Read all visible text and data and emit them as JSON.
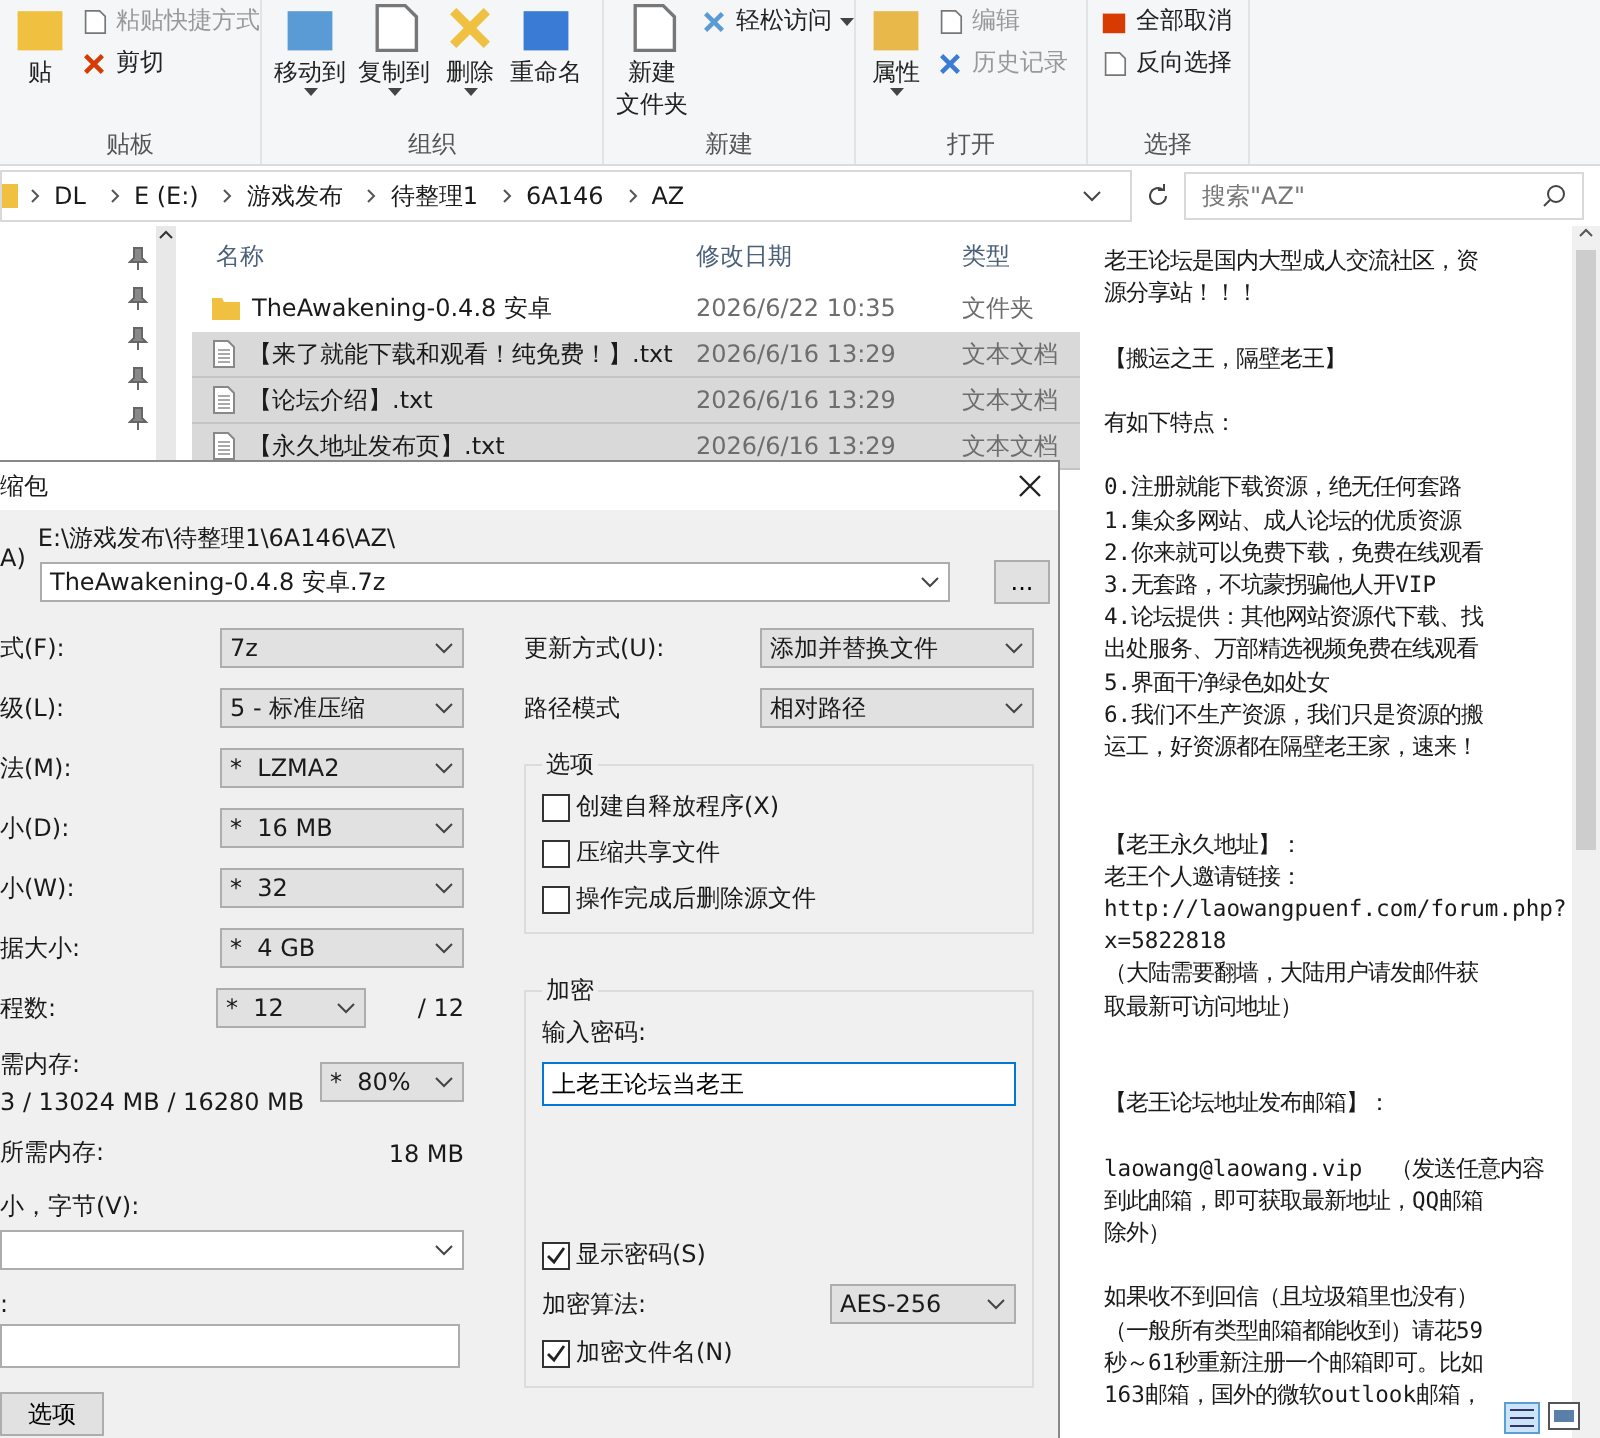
{
  "ribbon": {
    "groups": [
      {
        "label": "贴板",
        "items": [
          {
            "lines": [
              "贴"
            ],
            "kind": "large",
            "disabled": false,
            "dropdown": false
          },
          {
            "lines": [
              "粘贴快捷方式"
            ],
            "kind": "small",
            "disabled": true,
            "dropdown": false
          },
          {
            "lines": [
              "剪切"
            ],
            "kind": "small",
            "disabled": false,
            "dropdown": false
          }
        ]
      },
      {
        "label": "组织",
        "items": [
          {
            "lines": [
              "移动到"
            ],
            "kind": "large",
            "disabled": false,
            "dropdown": true
          },
          {
            "lines": [
              "复制到"
            ],
            "kind": "large",
            "disabled": false,
            "dropdown": true
          },
          {
            "lines": [
              "删除"
            ],
            "kind": "large",
            "disabled": false,
            "dropdown": true
          },
          {
            "lines": [
              "重命名"
            ],
            "kind": "large",
            "disabled": false,
            "dropdown": false
          }
        ]
      },
      {
        "label": "新建",
        "items": [
          {
            "lines": [
              "新建",
              "文件夹"
            ],
            "kind": "large",
            "disabled": false,
            "dropdown": false
          },
          {
            "lines": [
              "轻松访问"
            ],
            "kind": "small",
            "disabled": false,
            "dropdown": true
          }
        ]
      },
      {
        "label": "打开",
        "items": [
          {
            "lines": [
              "属性"
            ],
            "kind": "large",
            "disabled": false,
            "dropdown": true
          },
          {
            "lines": [
              "编辑"
            ],
            "kind": "small",
            "disabled": true,
            "dropdown": false
          },
          {
            "lines": [
              "历史记录"
            ],
            "kind": "small",
            "disabled": true,
            "dropdown": false
          }
        ]
      },
      {
        "label": "选择",
        "items": [
          {
            "lines": [
              "全部取消"
            ],
            "kind": "small",
            "disabled": false,
            "dropdown": false
          },
          {
            "lines": [
              "反向选择"
            ],
            "kind": "small",
            "disabled": false,
            "dropdown": false
          }
        ]
      }
    ]
  },
  "address": {
    "crumbs": [
      "DL",
      "E (E:)",
      "游戏发布",
      "待整理1",
      "6A146",
      "AZ"
    ],
    "search_placeholder": "搜索\"AZ\""
  },
  "files": {
    "columns": [
      "名称",
      "修改日期",
      "类型"
    ],
    "rows": [
      {
        "name": "TheAwakening-0.4.8 安卓",
        "date": "2026/6/22 10:35",
        "type": "文件夹",
        "kind": "folder",
        "selected": false
      },
      {
        "name": "【来了就能下载和观看！纯免费！】.txt",
        "date": "2026/6/16 13:29",
        "type": "文本文档",
        "kind": "text",
        "selected": true
      },
      {
        "name": "【论坛介绍】.txt",
        "date": "2026/6/16 13:29",
        "type": "文本文档",
        "kind": "text",
        "selected": true
      },
      {
        "name": "【永久地址发布页】.txt",
        "date": "2026/6/16 13:29",
        "type": "文本文档",
        "kind": "text",
        "selected": true
      }
    ]
  },
  "preview": {
    "blocks": [
      {
        "kind": "plain",
        "lines": [
          "老王论坛是国内大型成人交流社区，资",
          "源分享站！！！"
        ]
      },
      {
        "kind": "plain",
        "lines": [
          "【搬运之王，隔壁老王】"
        ]
      },
      {
        "kind": "plain",
        "lines": [
          "有如下特点："
        ]
      },
      {
        "kind": "plain",
        "lines": [
          "0.注册就能下载资源，绝无任何套路",
          "1.集众多网站、成人论坛的优质资源",
          "2.你来就可以免费下载，免费在线观看",
          "3.无套路，不坑蒙拐骗他人开VIP",
          "4.论坛提供：其他网站资源代下载、找",
          "出处服务、万部精选视频免费在线观看",
          "5.界面干净绿色如处女",
          "6.我们不生产资源，我们只是资源的搬",
          "运工，好资源都在隔壁老王家，速来！"
        ]
      },
      {
        "kind": "section",
        "lines": [
          "【老王永久地址】：",
          "老王个人邀请链接：",
          "http://laowangpuenf.com/forum.php?",
          "x=5822818",
          "（大陆需要翻墙，大陆用户请发邮件获",
          "取最新可访问地址）"
        ]
      },
      {
        "kind": "section",
        "lines": [
          "【老王论坛地址发布邮箱】："
        ]
      },
      {
        "kind": "plain",
        "lines": [
          "laowang@laowang.vip  （发送任意内容",
          "到此邮箱，即可获取最新地址，QQ邮箱",
          "除外）"
        ]
      },
      {
        "kind": "plain",
        "lines": [
          "如果收不到回信（且垃圾箱里也没有）",
          "（一般所有类型邮箱都能收到）请花59",
          "秒～61秒重新注册一个邮箱即可。比如",
          "163邮箱，国外的微软outlook邮箱，"
        ]
      }
    ]
  },
  "dialog": {
    "title": "缩包",
    "archive_label": "A)",
    "path": "E:\\游戏发布\\待整理1\\6A146\\AZ\\",
    "archive_name": "TheAwakening-0.4.8 安卓.7z",
    "browse": "...",
    "left": [
      {
        "label": "式(F):",
        "value": "7z",
        "kind": "combo"
      },
      {
        "label": "级(L):",
        "value": "5 - 标准压缩",
        "kind": "combo"
      },
      {
        "label": "法(M):",
        "value": "*  LZMA2",
        "kind": "combo"
      },
      {
        "label": "小(D):",
        "value": "*  16 MB",
        "kind": "combo"
      },
      {
        "label": "小(W):",
        "value": "*  32",
        "kind": "combo"
      },
      {
        "label": "据大小:",
        "value": "*  4 GB",
        "kind": "combo"
      },
      {
        "label": "程数:",
        "value": "*  12",
        "extra": "/ 12",
        "kind": "short"
      },
      {
        "label": "需内存:",
        "sub": "3 / 13024 MB / 16280 MB",
        "value": "*  80%",
        "kind": "memory"
      },
      {
        "label": "所需内存:",
        "extra": "18 MB",
        "kind": "info"
      },
      {
        "label": "小，字节(V):",
        "kind": "wide"
      },
      {
        "label": ":",
        "kind": "text"
      }
    ],
    "update_label": "更新方式(U):",
    "update_value": "添加并替换文件",
    "path_label": "路径模式",
    "path_value": "相对路径",
    "options": {
      "legend": "选项",
      "checks": [
        {
          "label": "创建自释放程序(X)",
          "checked": false
        },
        {
          "label": "压缩共享文件",
          "checked": false
        },
        {
          "label": "操作完成后删除源文件",
          "checked": false
        }
      ]
    },
    "encryption": {
      "legend": "加密",
      "password_label": "输入密码:",
      "password": "上老王论坛当老王",
      "show_password": {
        "label": "显示密码(S)",
        "checked": true
      },
      "method_label": "加密算法:",
      "method": "AES-256",
      "encrypt_names": {
        "label": "加密文件名(N)",
        "checked": true
      }
    },
    "options_button": "选项"
  }
}
